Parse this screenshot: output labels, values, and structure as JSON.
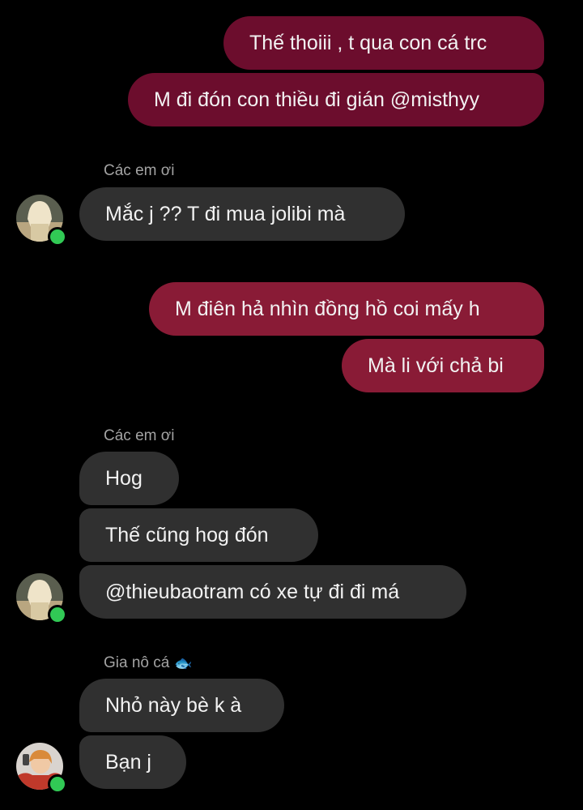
{
  "thread": {
    "group1": {
      "outgoing": [
        {
          "text": "Thế thoiii , t qua con cá trc"
        },
        {
          "text": "M đi đón con thiều đi gián @misthyy"
        }
      ]
    },
    "group2": {
      "sender": "Các em ơi",
      "messages": [
        {
          "text": "Mắc j ?? T đi mua jolibi mà"
        }
      ]
    },
    "group3": {
      "outgoing": [
        {
          "text": "M điên hả nhìn đồng hồ coi mấy h"
        },
        {
          "text": "Mà li với chả bi"
        }
      ]
    },
    "group4": {
      "sender": "Các em ơi",
      "messages": [
        {
          "text": "Hog"
        },
        {
          "text": "Thế cũng hog đón"
        },
        {
          "text": "@thieubaotram có xe tự đi đi má"
        }
      ]
    },
    "group5": {
      "sender": "Gia nô cá",
      "sender_icon": "fish-emoji",
      "messages": [
        {
          "text": "Nhỏ này bè k à"
        },
        {
          "text": "Bạn j"
        }
      ]
    }
  },
  "colors": {
    "background": "#000000",
    "outgoing_dark": "#6c0d2d",
    "outgoing_light": "#891b36",
    "incoming": "#303030",
    "online_dot": "#31c955"
  }
}
